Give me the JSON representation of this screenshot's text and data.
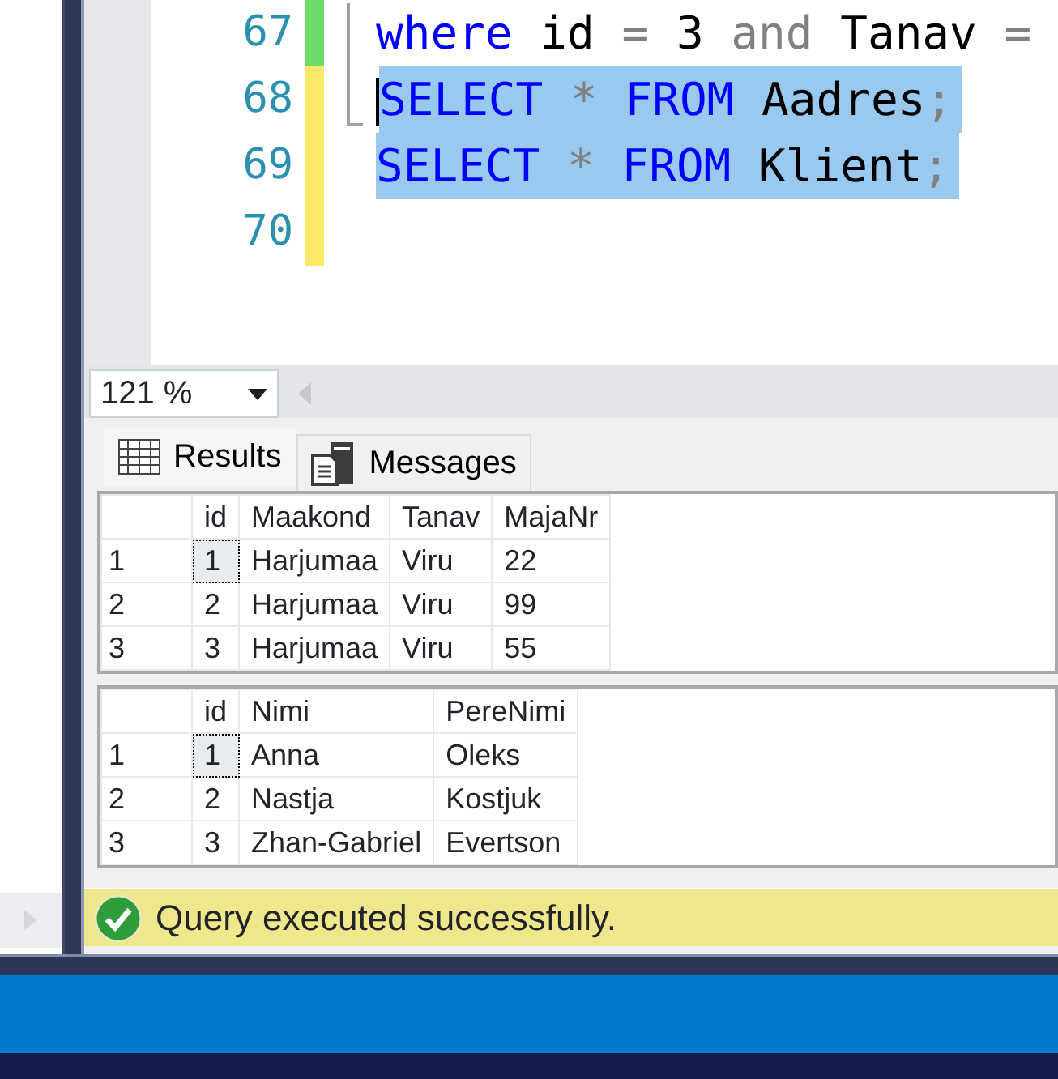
{
  "editor": {
    "lines": [
      {
        "number": "67",
        "color": "#6ddc6a",
        "selected": false,
        "tokens": [
          {
            "text": "where",
            "kind": "keyword"
          },
          {
            "text": "id",
            "kind": "name"
          },
          {
            "text": "=",
            "kind": "operator"
          },
          {
            "text": "3",
            "kind": "name"
          },
          {
            "text": "and",
            "kind": "operator"
          },
          {
            "text": "Tanav",
            "kind": "name"
          },
          {
            "text": "=",
            "kind": "operator"
          }
        ]
      },
      {
        "number": "68",
        "color": "#fde967",
        "selected": true,
        "tokens": [
          {
            "text": "SELECT",
            "kind": "keyword"
          },
          {
            "text": "*",
            "kind": "operator"
          },
          {
            "text": "FROM",
            "kind": "keyword"
          },
          {
            "text": "Aadres",
            "kind": "name"
          },
          {
            "text": ";",
            "kind": "terminator"
          }
        ]
      },
      {
        "number": "69",
        "color": "#fde967",
        "selected": true,
        "tokens": [
          {
            "text": "SELECT",
            "kind": "keyword"
          },
          {
            "text": "*",
            "kind": "operator"
          },
          {
            "text": "FROM",
            "kind": "keyword"
          },
          {
            "text": "Klient",
            "kind": "name"
          },
          {
            "text": ";",
            "kind": "terminator"
          }
        ]
      },
      {
        "number": "70",
        "color": "#fde967"
      }
    ]
  },
  "zoom": {
    "value": "121 %"
  },
  "tabs": [
    {
      "label": "Results",
      "selected": true
    },
    {
      "label": "Messages",
      "selected": false
    }
  ],
  "grids": [
    {
      "columns": [
        "id",
        "Maakond",
        "Tanav",
        "MajaNr"
      ],
      "rows": [
        {
          "number": "1",
          "selected": true,
          "cells": [
            "1",
            "Harjumaa",
            "Viru",
            "22"
          ]
        },
        {
          "number": "2",
          "selected": false,
          "cells": [
            "2",
            "Harjumaa",
            "Viru",
            "99"
          ]
        },
        {
          "number": "3",
          "selected": false,
          "cells": [
            "3",
            "Harjumaa",
            "Viru",
            "55"
          ]
        }
      ]
    },
    {
      "columns": [
        "id",
        "Nimi",
        "PereNimi"
      ],
      "rows": [
        {
          "number": "1",
          "selected": true,
          "cells": [
            "1",
            "Anna",
            "Oleks"
          ]
        },
        {
          "number": "2",
          "selected": false,
          "cells": [
            "2",
            "Nastja",
            "Kostjuk"
          ]
        },
        {
          "number": "3",
          "selected": false,
          "cells": [
            "3",
            "Zhan-Gabriel",
            "Evertson"
          ]
        }
      ]
    }
  ],
  "status_bar": {
    "text": "Query executed successfully."
  }
}
